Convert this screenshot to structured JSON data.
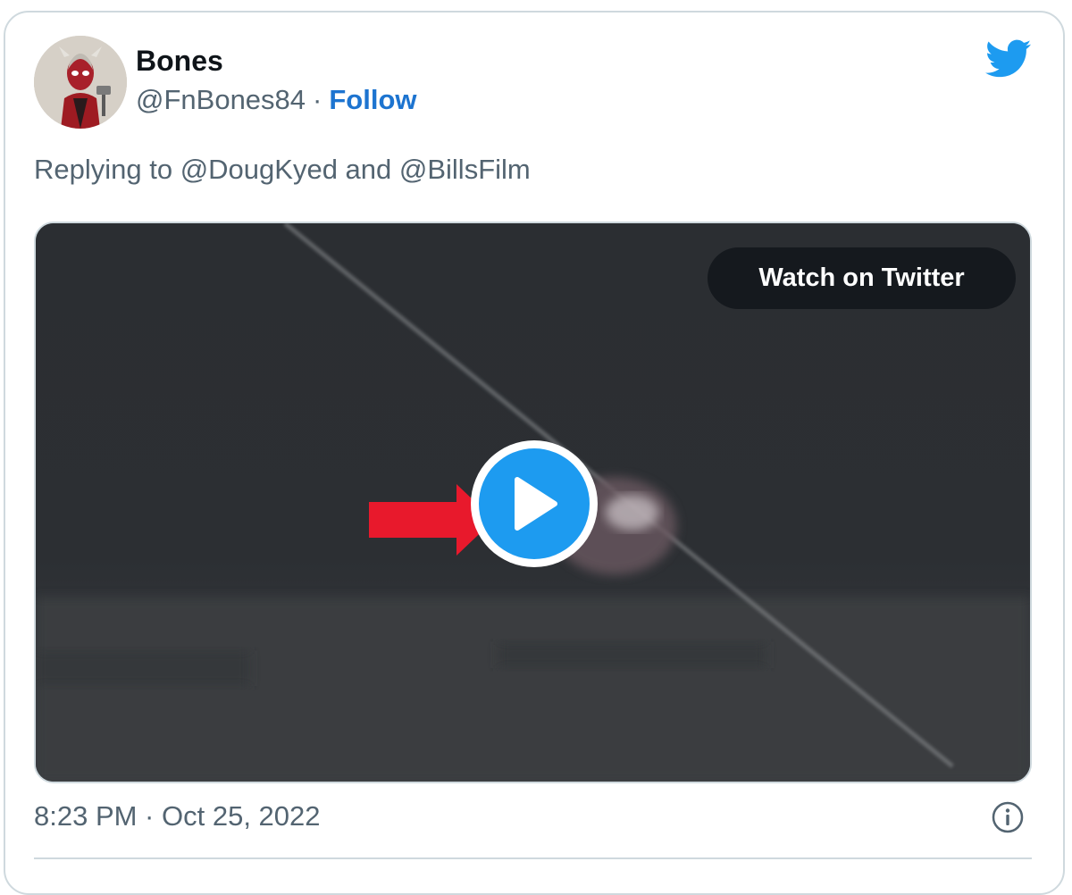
{
  "author": {
    "display_name": "Bones",
    "handle": "@FnBones84",
    "separator": "·",
    "follow_label": "Follow"
  },
  "reply": {
    "text": "Replying to @DougKyed and @BillsFilm"
  },
  "media": {
    "watch_label": "Watch on Twitter",
    "play_icon": "play-icon",
    "arrow_icon": "red-arrow-icon"
  },
  "footer": {
    "timestamp": "8:23 PM · Oct 25, 2022",
    "info_icon": "info-icon"
  },
  "brand": {
    "logo": "twitter-bird-icon",
    "accent_color": "#1d9bf0",
    "link_color": "#1d74d0",
    "arrow_color": "#e8192c"
  }
}
